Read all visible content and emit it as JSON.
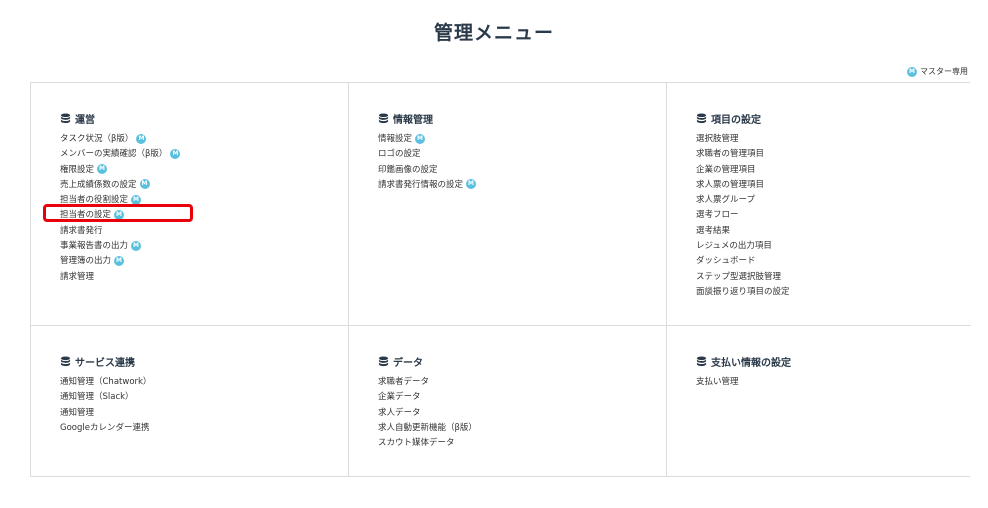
{
  "page": {
    "title": "管理メニュー"
  },
  "legend": {
    "badge": "M",
    "label": "マスター専用"
  },
  "sections": [
    {
      "title": "運営",
      "items": [
        {
          "label": "タスク状況（β版）",
          "master": true
        },
        {
          "label": "メンバーの実績確認（β版）",
          "master": true
        },
        {
          "label": "権限設定",
          "master": true
        },
        {
          "label": "売上成績係数の設定",
          "master": true
        },
        {
          "label": "担当者の役割設定",
          "master": true
        },
        {
          "label": "担当者の設定",
          "master": true
        },
        {
          "label": "請求書発行",
          "master": false
        },
        {
          "label": "事業報告書の出力",
          "master": true
        },
        {
          "label": "管理簿の出力",
          "master": true
        },
        {
          "label": "請求管理",
          "master": false
        }
      ]
    },
    {
      "title": "情報管理",
      "items": [
        {
          "label": "情報設定",
          "master": true
        },
        {
          "label": "ロゴの設定",
          "master": false
        },
        {
          "label": "印鑑画像の設定",
          "master": false
        },
        {
          "label": "請求書発行情報の設定",
          "master": true
        }
      ]
    },
    {
      "title": "項目の設定",
      "items": [
        {
          "label": "選択肢管理",
          "master": false
        },
        {
          "label": "求職者の管理項目",
          "master": false
        },
        {
          "label": "企業の管理項目",
          "master": false
        },
        {
          "label": "求人票の管理項目",
          "master": false
        },
        {
          "label": "求人票グループ",
          "master": false
        },
        {
          "label": "選考フロー",
          "master": false
        },
        {
          "label": "選考結果",
          "master": false
        },
        {
          "label": "レジュメの出力項目",
          "master": false
        },
        {
          "label": "ダッシュボード",
          "master": false
        },
        {
          "label": "ステップ型選択肢管理",
          "master": false
        },
        {
          "label": "面談振り返り項目の設定",
          "master": false
        }
      ]
    },
    {
      "title": "サービス連携",
      "items": [
        {
          "label": "通知管理（Chatwork）",
          "master": false
        },
        {
          "label": "通知管理（Slack）",
          "master": false
        },
        {
          "label": "通知管理",
          "master": false
        },
        {
          "label": "Googleカレンダー連携",
          "master": false
        }
      ]
    },
    {
      "title": "データ",
      "items": [
        {
          "label": "求職者データ",
          "master": false
        },
        {
          "label": "企業データ",
          "master": false
        },
        {
          "label": "求人データ",
          "master": false
        },
        {
          "label": "求人自動更新機能（β版）",
          "master": false
        },
        {
          "label": "スカウト媒体データ",
          "master": false
        }
      ]
    },
    {
      "title": "支払い情報の設定",
      "items": [
        {
          "label": "支払い管理",
          "master": false
        }
      ]
    }
  ],
  "colors": {
    "badge": "#5bc0de",
    "highlight": "#e8000b",
    "title": "#2b3a4a"
  }
}
